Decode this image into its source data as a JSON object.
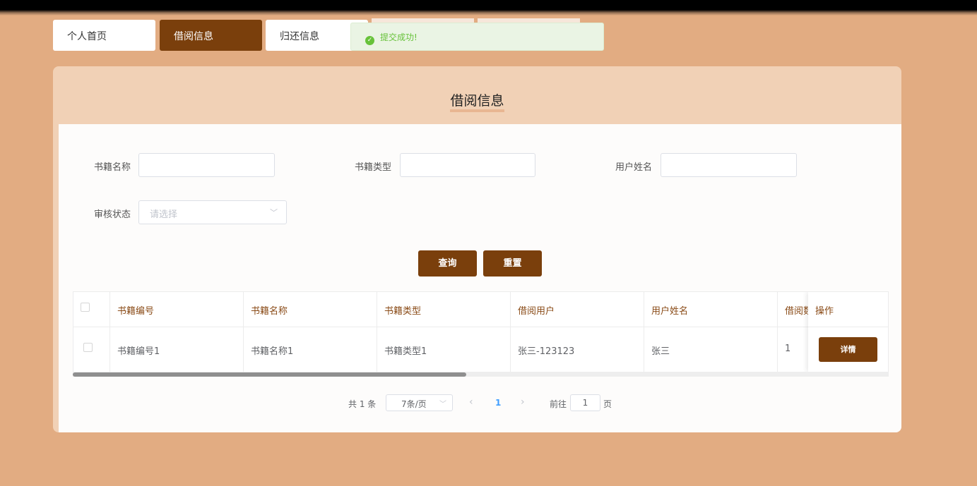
{
  "tabs": [
    {
      "label": "个人首页"
    },
    {
      "label": "借阅信息"
    },
    {
      "label": "归还信息"
    }
  ],
  "toast": {
    "message": "提交成功!"
  },
  "page_title": "借阅信息",
  "search": {
    "book_name_label": "书籍名称",
    "book_type_label": "书籍类型",
    "user_name_label": "用户姓名",
    "audit_status_label": "审核状态",
    "audit_status_placeholder": "请选择",
    "query_button": "查询",
    "reset_button": "重置"
  },
  "table": {
    "headers": [
      "书籍编号",
      "书籍名称",
      "书籍类型",
      "借阅用户",
      "用户姓名",
      "借阅数",
      "操作"
    ],
    "rows": [
      [
        "书籍编号1",
        "书籍名称1",
        "书籍类型1",
        "张三-123123",
        "张三",
        "1"
      ]
    ],
    "detail_button": "详情"
  },
  "pagination": {
    "total_text": "共 1 条",
    "page_size": "7条/页",
    "current_page": "1",
    "goto_label": "前往",
    "goto_value": "1",
    "page_unit": "页",
    "prev_icon": "‹",
    "next_icon": "›"
  },
  "colors": {
    "background": "#e2ac82",
    "accent": "#7a3f0c",
    "card_header": "#f1d1b6",
    "success": "#67c23a"
  }
}
